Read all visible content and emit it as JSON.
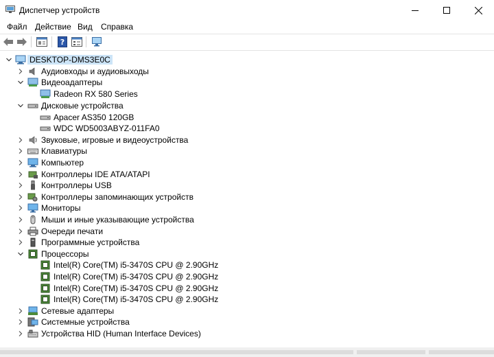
{
  "window": {
    "title": "Диспетчер устройств",
    "accent": "#cce4f7"
  },
  "menu": [
    "Файл",
    "Действие",
    "Вид",
    "Справка"
  ],
  "toolbar": {
    "icons": [
      "back-arrow-icon",
      "forward-arrow-icon",
      "properties-icon",
      "help-icon",
      "view-icon",
      "monitor-scan-icon"
    ]
  },
  "tree": {
    "root": "DESKTOP-DMS3E0C",
    "items": [
      {
        "label": "Аудиовходы и аудиовыходы",
        "expanded": false
      },
      {
        "label": "Видеоадаптеры",
        "expanded": true
      },
      {
        "label": "Radeon RX 580 Series",
        "child": true
      },
      {
        "label": "Дисковые устройства",
        "expanded": true
      },
      {
        "label": "Apacer AS350 120GB",
        "child": true
      },
      {
        "label": "WDC WD5003ABYZ-011FA0",
        "child": true
      },
      {
        "label": "Звуковые, игровые и видеоустройства",
        "expanded": false
      },
      {
        "label": "Клавиатуры",
        "expanded": false
      },
      {
        "label": "Компьютер",
        "expanded": false
      },
      {
        "label": "Контроллеры IDE ATA/ATAPI",
        "expanded": false
      },
      {
        "label": "Контроллеры USB",
        "expanded": false
      },
      {
        "label": "Контроллеры запоминающих устройств",
        "expanded": false
      },
      {
        "label": "Мониторы",
        "expanded": false
      },
      {
        "label": "Мыши и иные указывающие устройства",
        "expanded": false
      },
      {
        "label": "Очереди печати",
        "expanded": false
      },
      {
        "label": "Программные устройства",
        "expanded": false
      },
      {
        "label": "Процессоры",
        "expanded": true
      },
      {
        "label": "Intel(R) Core(TM) i5-3470S CPU @ 2.90GHz",
        "child": true
      },
      {
        "label": "Intel(R) Core(TM) i5-3470S CPU @ 2.90GHz",
        "child": true
      },
      {
        "label": "Intel(R) Core(TM) i5-3470S CPU @ 2.90GHz",
        "child": true
      },
      {
        "label": "Intel(R) Core(TM) i5-3470S CPU @ 2.90GHz",
        "child": true
      },
      {
        "label": "Сетевые адаптеры",
        "expanded": false
      },
      {
        "label": "Системные устройства",
        "expanded": false
      },
      {
        "label": "Устройства HID (Human Interface Devices)",
        "expanded": false
      }
    ]
  }
}
